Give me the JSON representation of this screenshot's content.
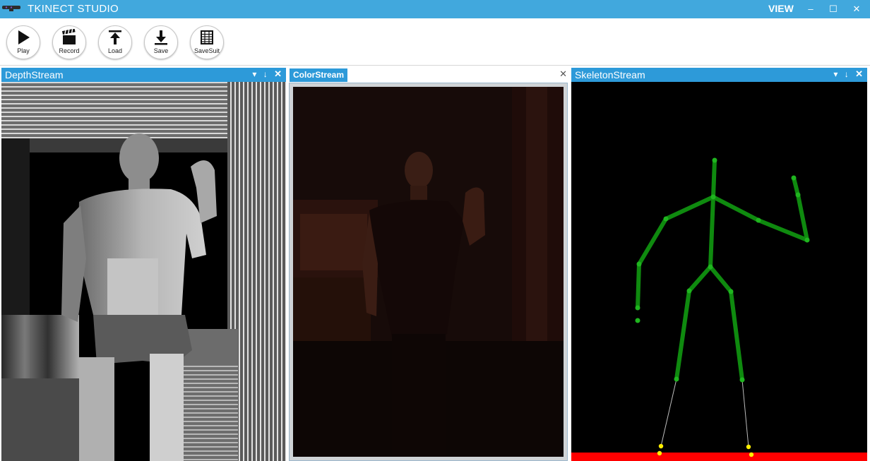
{
  "window": {
    "title": "TKINECT STUDIO",
    "menu_view": "VIEW",
    "minimize_glyph": "–",
    "maximize_glyph": "☐",
    "close_glyph": "✕"
  },
  "toolbar": {
    "buttons": [
      {
        "label": "Play",
        "icon": "play-icon"
      },
      {
        "label": "Record",
        "icon": "clapperboard-icon"
      },
      {
        "label": "Load",
        "icon": "upload-icon"
      },
      {
        "label": "Save",
        "icon": "download-icon"
      },
      {
        "label": "SaveSuit",
        "icon": "grid-icon"
      }
    ]
  },
  "panels": {
    "depth": {
      "title": "DepthStream",
      "dropdown_glyph": "▾",
      "pin_glyph": "↓",
      "close_glyph": "✕"
    },
    "color": {
      "title": "ColorStream",
      "close_glyph": "✕"
    },
    "skeleton": {
      "title": "SkeletonStream",
      "dropdown_glyph": "▾",
      "pin_glyph": "↓",
      "close_glyph": "✕"
    }
  },
  "colors": {
    "accent": "#41a8dd",
    "panel_header": "#2d9ad9",
    "bone": "#0f8a0f",
    "joint": "#1fb51f",
    "foot_joint": "#ffee00",
    "floor": "#ff0000"
  }
}
